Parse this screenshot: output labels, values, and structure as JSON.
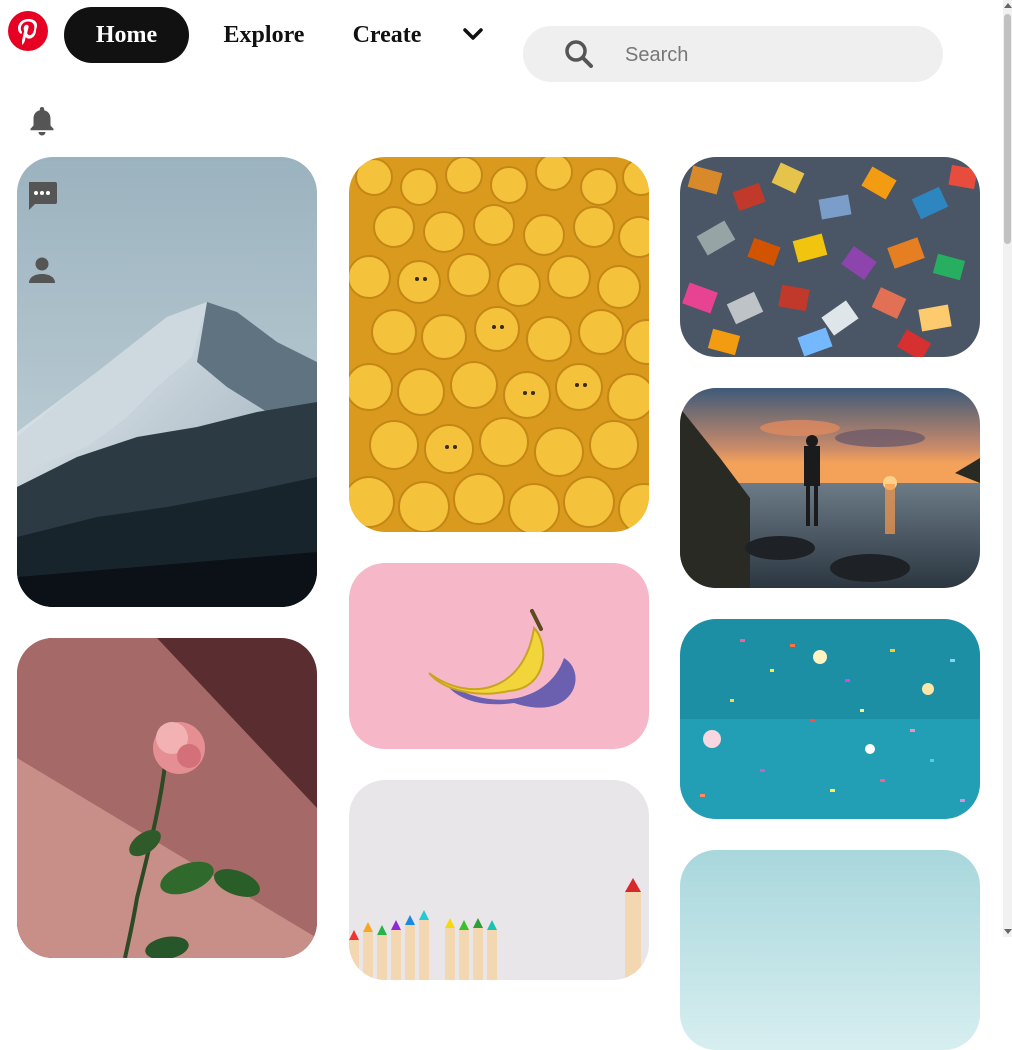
{
  "nav": {
    "home": "Home",
    "explore": "Explore",
    "create": "Create"
  },
  "search": {
    "placeholder": "Search",
    "value": ""
  },
  "icons": {
    "logo": "pinterest-logo",
    "more": "chevron-down-icon",
    "search": "search-icon",
    "notifications": "bell-icon",
    "messages": "message-icon",
    "profile": "user-icon"
  },
  "colors": {
    "brand": "#e60023",
    "active_nav_bg": "#111111",
    "search_bg": "#efefef"
  },
  "pins": [
    {
      "subject": "snowy mountain"
    },
    {
      "subject": "rose"
    },
    {
      "subject": "yellow toy heads"
    },
    {
      "subject": "banana"
    },
    {
      "subject": "colored pencils"
    },
    {
      "subject": "jigsaw puzzle pieces"
    },
    {
      "subject": "person at sunset"
    },
    {
      "subject": "confetti"
    },
    {
      "subject": "sky"
    }
  ]
}
